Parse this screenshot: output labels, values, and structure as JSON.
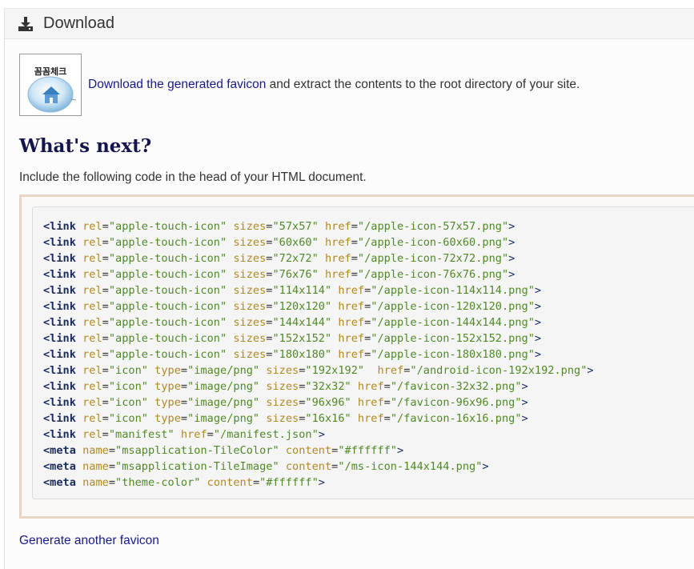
{
  "panel": {
    "title": "Download",
    "icon": "download-icon"
  },
  "favicon": {
    "image_text": "꼼꼼체크",
    "link_text": "Download the generated favicon",
    "rest_text": " and extract the contents to the root directory of your site."
  },
  "next": {
    "heading": "What's next?",
    "intro": "Include the following code in the head of your HTML document."
  },
  "code_lines": [
    {
      "tag": "link",
      "attrs": [
        [
          "rel",
          "apple-touch-icon"
        ],
        [
          "sizes",
          "57x57"
        ],
        [
          "href",
          "/apple-icon-57x57.png"
        ]
      ]
    },
    {
      "tag": "link",
      "attrs": [
        [
          "rel",
          "apple-touch-icon"
        ],
        [
          "sizes",
          "60x60"
        ],
        [
          "href",
          "/apple-icon-60x60.png"
        ]
      ]
    },
    {
      "tag": "link",
      "attrs": [
        [
          "rel",
          "apple-touch-icon"
        ],
        [
          "sizes",
          "72x72"
        ],
        [
          "href",
          "/apple-icon-72x72.png"
        ]
      ]
    },
    {
      "tag": "link",
      "attrs": [
        [
          "rel",
          "apple-touch-icon"
        ],
        [
          "sizes",
          "76x76"
        ],
        [
          "href",
          "/apple-icon-76x76.png"
        ]
      ]
    },
    {
      "tag": "link",
      "attrs": [
        [
          "rel",
          "apple-touch-icon"
        ],
        [
          "sizes",
          "114x114"
        ],
        [
          "href",
          "/apple-icon-114x114.png"
        ]
      ]
    },
    {
      "tag": "link",
      "attrs": [
        [
          "rel",
          "apple-touch-icon"
        ],
        [
          "sizes",
          "120x120"
        ],
        [
          "href",
          "/apple-icon-120x120.png"
        ]
      ]
    },
    {
      "tag": "link",
      "attrs": [
        [
          "rel",
          "apple-touch-icon"
        ],
        [
          "sizes",
          "144x144"
        ],
        [
          "href",
          "/apple-icon-144x144.png"
        ]
      ]
    },
    {
      "tag": "link",
      "attrs": [
        [
          "rel",
          "apple-touch-icon"
        ],
        [
          "sizes",
          "152x152"
        ],
        [
          "href",
          "/apple-icon-152x152.png"
        ]
      ]
    },
    {
      "tag": "link",
      "attrs": [
        [
          "rel",
          "apple-touch-icon"
        ],
        [
          "sizes",
          "180x180"
        ],
        [
          "href",
          "/apple-icon-180x180.png"
        ]
      ]
    },
    {
      "tag": "link",
      "attrs": [
        [
          "rel",
          "icon"
        ],
        [
          "type",
          "image/png"
        ],
        [
          "sizes",
          "192x192"
        ],
        [
          "href",
          "/android-icon-192x192.png"
        ]
      ],
      "extra_space_before_last": true
    },
    {
      "tag": "link",
      "attrs": [
        [
          "rel",
          "icon"
        ],
        [
          "type",
          "image/png"
        ],
        [
          "sizes",
          "32x32"
        ],
        [
          "href",
          "/favicon-32x32.png"
        ]
      ]
    },
    {
      "tag": "link",
      "attrs": [
        [
          "rel",
          "icon"
        ],
        [
          "type",
          "image/png"
        ],
        [
          "sizes",
          "96x96"
        ],
        [
          "href",
          "/favicon-96x96.png"
        ]
      ]
    },
    {
      "tag": "link",
      "attrs": [
        [
          "rel",
          "icon"
        ],
        [
          "type",
          "image/png"
        ],
        [
          "sizes",
          "16x16"
        ],
        [
          "href",
          "/favicon-16x16.png"
        ]
      ]
    },
    {
      "tag": "link",
      "attrs": [
        [
          "rel",
          "manifest"
        ],
        [
          "href",
          "/manifest.json"
        ]
      ]
    },
    {
      "tag": "meta",
      "attrs": [
        [
          "name",
          "msapplication-TileColor"
        ],
        [
          "content",
          "#ffffff"
        ]
      ]
    },
    {
      "tag": "meta",
      "attrs": [
        [
          "name",
          "msapplication-TileImage"
        ],
        [
          "content",
          "/ms-icon-144x144.png"
        ]
      ]
    },
    {
      "tag": "meta",
      "attrs": [
        [
          "name",
          "theme-color"
        ],
        [
          "content",
          "#ffffff"
        ]
      ]
    }
  ],
  "footer": {
    "another_link": "Generate another favicon"
  },
  "colors": {
    "tag": "#1a2b5c",
    "attr": "#b0891f",
    "value": "#4f8a24",
    "link": "#1a1a8c",
    "code_border": "#e8d5c4"
  }
}
